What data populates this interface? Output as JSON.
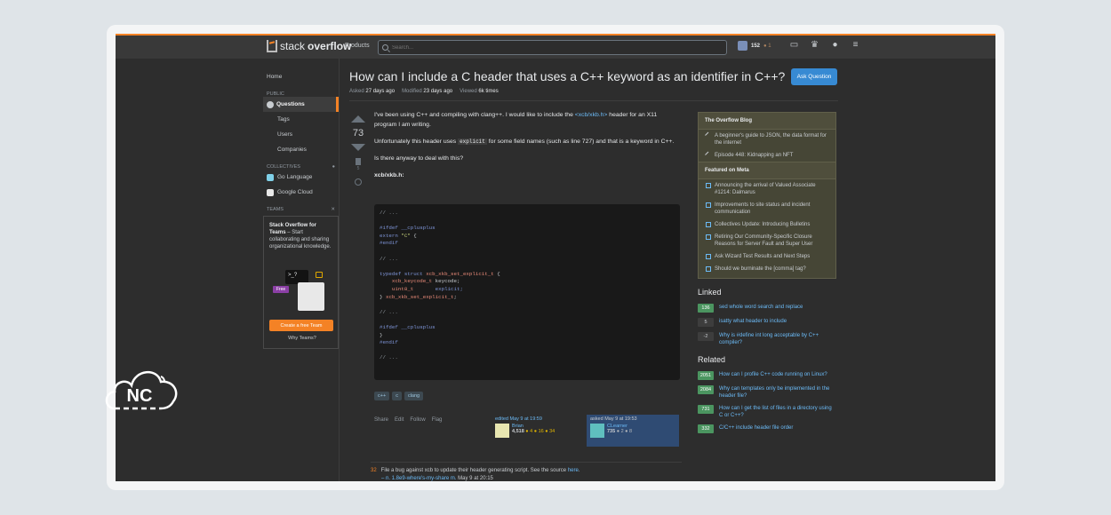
{
  "topbar": {
    "logo_plain": "stack",
    "logo_bold": "overflow",
    "products": "Products",
    "search_placeholder": "Search...",
    "reputation": "152",
    "bronze_badges": "● 1"
  },
  "leftnav": {
    "home": "Home",
    "public": "PUBLIC",
    "questions": "Questions",
    "tags": "Tags",
    "users": "Users",
    "companies": "Companies",
    "collectives": "COLLECTIVES",
    "coll_items": [
      {
        "label": "Go Language",
        "color": "#7fd0e8"
      },
      {
        "label": "Google Cloud",
        "color": "#e8e8e8"
      }
    ],
    "teams": "TEAMS",
    "teams_title": "Stack Overflow for Teams",
    "teams_desc": " – Start collaborating and sharing organizational knowledge.",
    "terminal": ">_?",
    "free": "Free",
    "create_team": "Create a free Team",
    "why_teams": "Why Teams?"
  },
  "question": {
    "title": "How can I include a C header that uses a C++ keyword as an identifier in C++?",
    "ask_button": "Ask Question",
    "asked_label": "Asked",
    "asked": "27 days ago",
    "modified_label": "Modified",
    "modified": "23 days ago",
    "viewed_label": "Viewed",
    "viewed": "6k times",
    "score": "73",
    "bookmarks": "5",
    "p1_before": "I've been using C++ and compiling with clang++. I would like to include the ",
    "p1_link": "<xcb/xkb.h>",
    "p1_after": " header for an X11 program I am writing.",
    "p2_before": "Unfortunately this header uses ",
    "p2_code": "explicit",
    "p2_after": " for some field names (such as line 727) and that is a keyword in C++.",
    "p3": "Is there anyway to deal with this?",
    "p4": "xcb/xkb.h:",
    "tags": [
      "c++",
      "c",
      "clang"
    ],
    "actions": [
      "Share",
      "Edit",
      "Follow",
      "Flag"
    ],
    "edited_label": "edited May 9 at 19:59",
    "editor_name": "Brian",
    "editor_rep": "4,518",
    "editor_badges": "● 4  ● 16  ● 34",
    "asked_box_label": "asked May 9 at 19:53",
    "asker_name": "CLearner",
    "asker_rep": "735",
    "asker_badges": "● 2  ● 8",
    "comment_score": "32",
    "comment_text": "File a bug against xcb to update their header generating script. See the source ",
    "comment_link": "here",
    "comment_user": "– n. 1.8e9-where's-my-share m.",
    "comment_time": " May 9 at 20:15"
  },
  "sidebar": {
    "blog_title": "The Overflow Blog",
    "blog_items": [
      "A beginner's guide to JSON, the data format for the internet",
      "Episode 448: Kidnapping an NFT"
    ],
    "meta_title": "Featured on Meta",
    "meta_items": [
      "Announcing the arrival of Valued Associate #1214: Dalmarus",
      "Improvements to site status and incident communication",
      "Collectives Update: Introducing Bulletins",
      "Retiring Our Community-Specific Closure Reasons for Server Fault and Super User",
      "Ask Wizard Test Results and Next Steps",
      "Should we burninate the [comma] tag?"
    ],
    "linked_title": "Linked",
    "linked": [
      {
        "score": "136",
        "text": "sed whole word search and replace",
        "accepted": true
      },
      {
        "score": "5",
        "text": "isatty what header to include",
        "accepted": false
      },
      {
        "score": "-2",
        "text": "Why is #define int long acceptable by C++ compiler?",
        "accepted": false
      }
    ],
    "related_title": "Related",
    "related": [
      {
        "score": "2051",
        "text": "How can I profile C++ code running on Linux?",
        "accepted": true
      },
      {
        "score": "2084",
        "text": "Why can templates only be implemented in the header file?",
        "accepted": true
      },
      {
        "score": "731",
        "text": "How can I get the list of files in a directory using C or C++?",
        "accepted": true
      },
      {
        "score": "332",
        "text": "C/C++ include header file order",
        "accepted": true
      }
    ]
  },
  "watermark": {
    "text": "NC"
  },
  "code": {
    "lines": [
      "// ...",
      "",
      "#ifdef __cplusplus",
      "extern \"C\" {",
      "#endif",
      "",
      "// ...",
      "",
      "typedef struct xcb_xkb_set_explicit_t {",
      "    xcb_keycode_t keycode;",
      "    uint8_t       explicit;",
      "} xcb_xkb_set_explicit_t;",
      "",
      "// ...",
      "",
      "#ifdef __cplusplus",
      "}",
      "#endif",
      "",
      "// ..."
    ]
  }
}
